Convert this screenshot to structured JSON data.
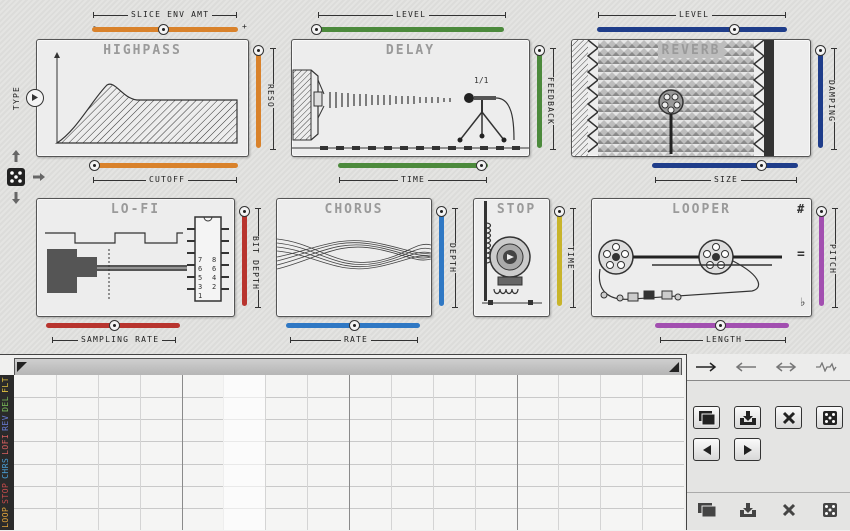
{
  "modules": {
    "highpass": {
      "title": "HIGHPASS",
      "type_label": "TYPE",
      "reso_label": "RESO",
      "cutoff_label": "CUTOFF",
      "slice_label": "SLICE ENV AMT",
      "minus": "-",
      "plus": "+"
    },
    "delay": {
      "title": "DELAY",
      "level_label": "LEVEL",
      "feedback_label": "FEEDBACK",
      "time_label": "TIME",
      "division": "1/1"
    },
    "reverb": {
      "title": "REVERB",
      "level_label": "LEVEL",
      "damping_label": "DAMPING",
      "size_label": "SIZE"
    },
    "lofi": {
      "title": "LO-FI",
      "bitdepth_label": "BIT DEPTH",
      "sampling_label": "SAMPLING RATE",
      "chip_left": [
        "7",
        "6",
        "5",
        "3",
        "1"
      ],
      "chip_right": [
        "8",
        "6",
        "4",
        "2"
      ]
    },
    "chorus": {
      "title": "CHORUS",
      "depth_label": "DEPTH",
      "rate_label": "RATE"
    },
    "stop": {
      "title": "STOP",
      "time_label": "TIME"
    },
    "looper": {
      "title": "LOOPER",
      "pitch_label": "PITCH",
      "length_label": "LENGTH",
      "sharp": "#",
      "flat": "♭",
      "equals": "="
    }
  },
  "slider_levels": {
    "slice_env": 0.5,
    "hp_reso": 0.05,
    "hp_cutoff": 0.0,
    "delay_level": 0.0,
    "delay_feedback": 0.0,
    "delay_time": 0.95,
    "reverb_level": 0.9,
    "reverb_damping": 0.0,
    "reverb_size": 0.75,
    "lofi_bit": 0.0,
    "lofi_sampling": 0.5,
    "chorus_depth": 0.0,
    "chorus_rate": 0.5,
    "stop_time": 0.0,
    "looper_pitch": 0.0,
    "looper_length": 0.5
  },
  "colors": {
    "orange": "#d9822b",
    "green": "#4c8a3c",
    "navy": "#1f3d8a",
    "red": "#b8342e",
    "blue": "#2f78c4",
    "yellow": "#c8b42a",
    "purple": "#a24fb0"
  },
  "sequencer": {
    "track_labels": [
      "LOOP",
      "STOP",
      "CHRS",
      "LOFI",
      "REV",
      "DEL",
      "FLT"
    ],
    "track_colors": [
      "#e0a43a",
      "#c84c4c",
      "#4aa0d8",
      "#d86060",
      "#6a7ed8",
      "#7bbf5a",
      "#e0c040"
    ],
    "right_tabs": [
      "arrow-right-icon",
      "arrow-left-icon",
      "arrow-both-icon",
      "wave-icon"
    ],
    "buttons": [
      "copy-icon",
      "paste-icon",
      "clear-icon",
      "random-icon",
      "shift-left-icon",
      "shift-right-icon"
    ],
    "bottom_icons": [
      "copy-icon",
      "paste-icon",
      "clear-icon",
      "random-icon"
    ]
  },
  "side_controls": [
    "arrow-up-icon",
    "dice-icon",
    "arrow-right-icon",
    "arrow-down-icon"
  ]
}
